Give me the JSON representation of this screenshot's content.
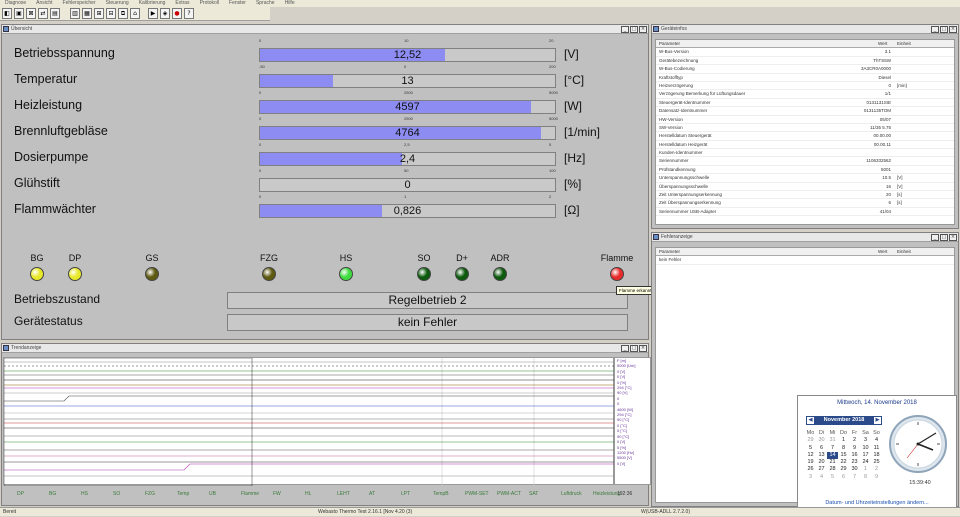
{
  "menu": {
    "items": [
      "Diagnose",
      "Ansicht",
      "Fehlerspeicher",
      "Steuerung",
      "Kalibrierung",
      "Extras",
      "Protokoll",
      "Fenster",
      "Sprache",
      "Hilfe"
    ]
  },
  "overview": {
    "title": "Übersicht",
    "params": [
      {
        "label": "Betriebsspannung",
        "value": "12,52",
        "unit": "[V]",
        "fraction": 0.626,
        "scale": [
          "0",
          "10",
          "20"
        ]
      },
      {
        "label": "Temperatur",
        "value": "13",
        "unit": "[°C]",
        "fraction": 0.248,
        "scale": [
          "-50",
          "0",
          "200"
        ]
      },
      {
        "label": "Heizleistung",
        "value": "4597",
        "unit": "[W]",
        "fraction": 0.919,
        "scale": [
          "0",
          "2500",
          "5000"
        ]
      },
      {
        "label": "Brennluftgebläse",
        "value": "4764",
        "unit": "[1/min]",
        "fraction": 0.953,
        "scale": [
          "0",
          "2500",
          "5000"
        ]
      },
      {
        "label": "Dosierpumpe",
        "value": "2,4",
        "unit": "[Hz]",
        "fraction": 0.48,
        "scale": [
          "0",
          "2,5",
          "5"
        ]
      },
      {
        "label": "Glühstift",
        "value": "0",
        "unit": "[%]",
        "fraction": 0,
        "scale": [
          "0",
          "50",
          "100"
        ]
      },
      {
        "label": "Flammwächter",
        "value": "0,826",
        "unit": "[Ω]",
        "fraction": 0.413,
        "scale": [
          "0",
          "1",
          "2"
        ]
      }
    ],
    "indicators": [
      {
        "label": "BG",
        "color": "#e8e82a"
      },
      {
        "label": "DP",
        "color": "#e8e82a"
      },
      {
        "label": "GS",
        "color": "#5e5a10"
      },
      {
        "label": "FZG",
        "color": "#5e5a10"
      },
      {
        "label": "HS",
        "color": "#3fdc3f"
      },
      {
        "label": "SO",
        "color": "#0c5a0c"
      },
      {
        "label": "D+",
        "color": "#0c5a0c"
      },
      {
        "label": "ADR",
        "color": "#0c5a0c"
      },
      {
        "label": "Flamme",
        "color": "#e82a2a"
      }
    ],
    "tooltip": "Flamme erkannt",
    "status": [
      {
        "label": "Betriebszustand",
        "value": "Regelbetrieb 2"
      },
      {
        "label": "Gerätestatus",
        "value": "kein Fehler"
      }
    ]
  },
  "device_info": {
    "title": "Geräteinfos",
    "columns": [
      "Parameter",
      "Wert",
      "Einheit"
    ],
    "rows": [
      [
        "W-Bus-Version",
        "3.1",
        ""
      ],
      [
        "Gerätebezeichnung",
        "ThTS5W",
        ""
      ],
      [
        "W-Bus-Codierung",
        "3A3CR0A0000",
        ""
      ],
      [
        "Kraftstofftyp",
        "Diesel",
        ""
      ],
      [
        "Heizverzögerung",
        "0",
        "[min]"
      ],
      [
        "Verzögerung Bemerkung für Lüftungsdauer",
        "1/1",
        ""
      ],
      [
        "Steuergerät-Identnummer",
        "0131131SIE",
        ""
      ],
      [
        "Datensatz-Identnummer",
        "0131135TOM",
        ""
      ],
      [
        "HW-Version",
        "05/07",
        ""
      ],
      [
        "SW-Version",
        "11/35 5.75",
        ""
      ],
      [
        "Herstelldatum Steuergerät",
        "00.00.00",
        ""
      ],
      [
        "Herstelldatum Heizgerät",
        "00.00.11",
        ""
      ],
      [
        "Kunden-Identnummer",
        "",
        ""
      ],
      [
        "Seriennummer",
        "1106332562",
        ""
      ],
      [
        "Prüfstandkennung",
        "5001",
        ""
      ],
      [
        "Unterspannungsschwelle",
        "10.5",
        "[V]"
      ],
      [
        "Überspannungsschwelle",
        "16",
        "[V]"
      ],
      [
        "Zeit Unterspannungserkennung",
        "20",
        "[s]"
      ],
      [
        "Zeit Überspannungserkennung",
        "6",
        "[s]"
      ],
      [
        "Seriennummer USB-Adapter",
        "41/04",
        ""
      ]
    ]
  },
  "fault_display": {
    "title": "Fehleranzeige",
    "columns": [
      "Parameter",
      "Wert",
      "Einheit"
    ],
    "rows": [
      [
        "kein Fehler",
        "",
        ""
      ]
    ]
  },
  "trend": {
    "title": "Trendanzeige",
    "legend": [
      "F [m]",
      "5000 [Um]",
      "0 [V]",
      "0 [V]",
      "0 [%]",
      "294 [°C]",
      "90 [V]",
      "0",
      "0",
      "4600 [W]",
      "294 [°C]",
      "90 [°C]",
      "0 [°C]",
      "5 [°C]",
      "90 [°C]",
      "0 [V]",
      "5 [%]",
      "1200 [Hz]",
      "5500 [V]",
      "0 [V]"
    ],
    "axis_labels": [
      "DP",
      "BG",
      "HS",
      "SO",
      "FZG",
      "Temp",
      "UB",
      "Flamme",
      "FW",
      "HL",
      "LEHT",
      "AT",
      "LPT",
      "TempB",
      "PWM-SET",
      "PWM-ACT",
      "SAT",
      "Luftdruck",
      "Heizleistung"
    ],
    "time_label": "192:36"
  },
  "status_bar": {
    "left": "Bereit",
    "center": "Webasto Thermo Test 2.16.1 [Nov 4.20 (3)",
    "right": "W(USB-ADLL 2.7.2.0)"
  },
  "calendar": {
    "date_title": "Mittwoch, 14. November 2018",
    "month_label": "November 2018",
    "weekdays": [
      "Mo",
      "Di",
      "Mi",
      "Do",
      "Fr",
      "Sa",
      "So"
    ],
    "weeks": [
      [
        "29",
        "30",
        "31",
        "1",
        "2",
        "3",
        "4"
      ],
      [
        "5",
        "6",
        "7",
        "8",
        "9",
        "10",
        "11"
      ],
      [
        "12",
        "13",
        "14",
        "15",
        "16",
        "17",
        "18"
      ],
      [
        "19",
        "20",
        "21",
        "22",
        "23",
        "24",
        "25"
      ],
      [
        "26",
        "27",
        "28",
        "29",
        "30",
        "1",
        "2"
      ],
      [
        "3",
        "4",
        "5",
        "6",
        "7",
        "8",
        "9"
      ]
    ],
    "selected": "14",
    "time": "15:39:40",
    "link": "Datum- und Uhrzeiteinstellungen ändern..."
  }
}
